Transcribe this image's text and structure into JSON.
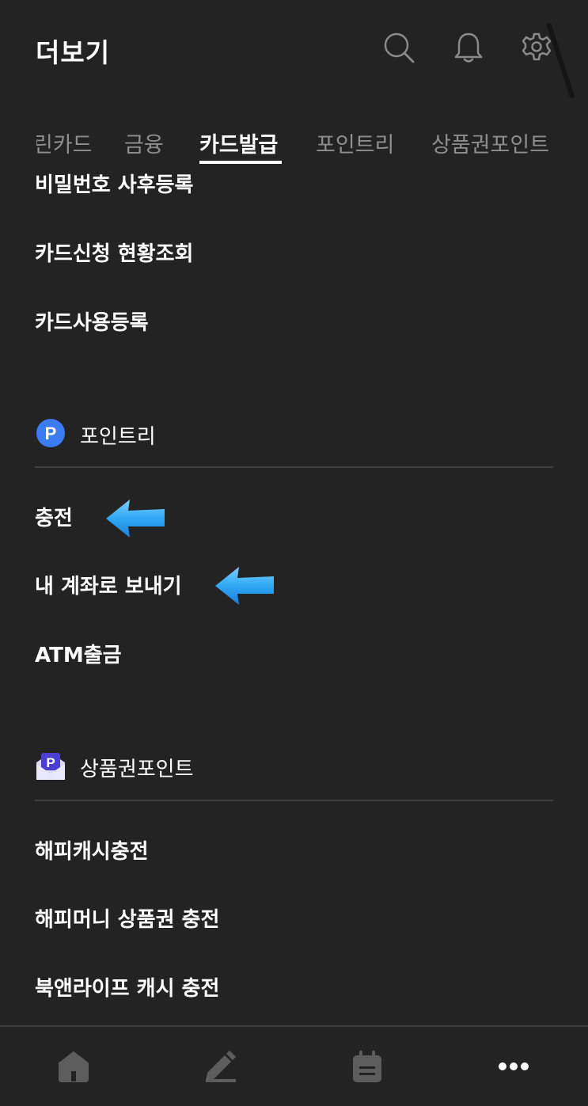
{
  "header": {
    "title": "더보기",
    "icons": [
      "search-icon",
      "bell-icon",
      "gear-icon"
    ]
  },
  "tabs": [
    {
      "label": "린카드",
      "active": false
    },
    {
      "label": "금융",
      "active": false
    },
    {
      "label": "카드발급",
      "active": true
    },
    {
      "label": "포인트리",
      "active": false
    },
    {
      "label": "상품권포인트",
      "active": false
    }
  ],
  "card_section": {
    "items": [
      {
        "label": "비밀번호 사후등록"
      },
      {
        "label": "카드신청 현황조회"
      },
      {
        "label": "카드사용등록"
      }
    ]
  },
  "pointree_section": {
    "title": "포인트리",
    "icon": "pointree-p-icon",
    "icon_letter": "P",
    "items": [
      {
        "label": "충전",
        "highlighted": true
      },
      {
        "label": "내 계좌로 보내기",
        "highlighted": true
      },
      {
        "label": "ATM출금",
        "highlighted": false
      }
    ]
  },
  "giftcard_section": {
    "title": "상품권포인트",
    "icon": "gift-envelope-icon",
    "icon_letter": "P",
    "items": [
      {
        "label": "해피캐시충전"
      },
      {
        "label": "해피머니 상품권 충전"
      },
      {
        "label": "북앤라이프 캐시 충전"
      }
    ]
  },
  "bottom_nav": {
    "items": [
      "home-icon",
      "pen-icon",
      "calendar-icon",
      "more-dots-icon"
    ]
  },
  "colors": {
    "background": "#232323",
    "text": "#ffffff",
    "inactive_tab": "#8e8e8e",
    "pointree_blue": "#3b7cf5",
    "arrow_blue": "#2fa8f5",
    "nav_icon": "#5d5d5d"
  }
}
